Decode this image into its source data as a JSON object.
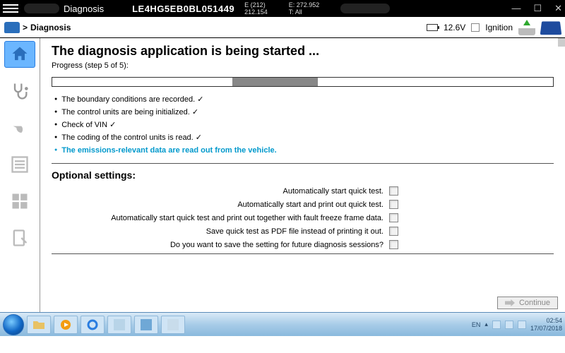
{
  "titlebar": {
    "app": "Diagnosis",
    "vin": "LE4HG5EB0BL051449",
    "info1_l1": "E (212)",
    "info1_l2": "212.154",
    "info2_l1": "E: 272.952",
    "info2_l2": "T: All"
  },
  "toolbar": {
    "breadcrumb": "Diagnosis",
    "voltage": "12.6V",
    "ignition_label": "Ignition"
  },
  "main": {
    "title": "The diagnosis application is being started ...",
    "progress_label": "Progress (step 5 of 5):",
    "progress_offset_pct": 36,
    "progress_width_pct": 17,
    "steps": [
      {
        "text": "The boundary conditions are recorded. ✓",
        "active": false
      },
      {
        "text": "The control units are being initialized. ✓",
        "active": false
      },
      {
        "text": "Check of VIN ✓",
        "active": false
      },
      {
        "text": "The coding of the control units is read. ✓",
        "active": false
      },
      {
        "text": "The emissions-relevant data are read out from the vehicle.",
        "active": true
      }
    ],
    "optional_title": "Optional settings:",
    "options": [
      "Automatically start quick test.",
      "Automatically start and print out quick test.",
      "Automatically start quick test and print out together with fault freeze frame data.",
      "Save quick test as PDF file instead of printing it out.",
      "Do you want to save the setting for future diagnosis sessions?"
    ],
    "continue_label": "Continue"
  },
  "taskbar": {
    "lang": "EN",
    "time": "02:54",
    "date": "17/07/2018"
  }
}
